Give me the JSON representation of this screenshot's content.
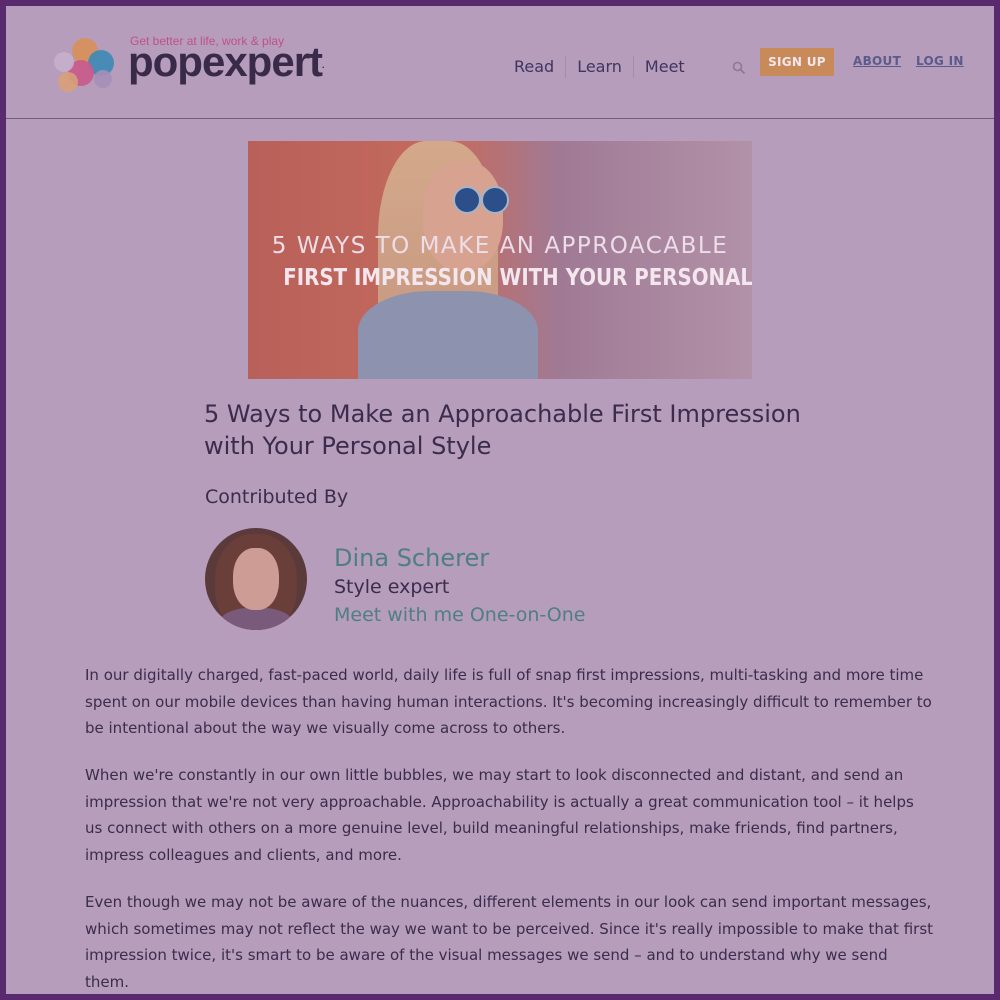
{
  "header": {
    "tagline": "Get better at life, work & play",
    "brand": "popexpert",
    "trademark": ".",
    "nav": [
      "Read",
      "Learn",
      "Meet"
    ],
    "signup_label": "SIGN UP",
    "about_label": "ABOUT",
    "login_label": "LOG IN",
    "search_icon": "search-icon"
  },
  "hero": {
    "line1": "5 WAYS TO MAKE AN APPROACABLE",
    "line2": "FIRST IMPRESSION WITH YOUR PERSONAL STYLE"
  },
  "article": {
    "title": "5 Ways to Make an Approachable First Impression with Your Personal Style",
    "contributed_by": "Contributed By",
    "author": {
      "name": "Dina Scherer",
      "role": "Style expert",
      "meet": "Meet with me One-on-One"
    },
    "paragraphs": [
      "In our digitally charged, fast-paced world, daily life is full of snap first impressions, multi-tasking and more time spent on our mobile devices than having human interactions. It's becoming increasingly difficult to remember to be intentional about the way we visually come across to others.",
      "When we're constantly in our own little bubbles, we may start to look disconnected and distant, and send an impression that we're not very approachable. Approachability is actually a great communication tool – it helps us connect with others on a more genuine level, build meaningful relationships, make friends, find partners, impress colleagues and clients, and more.",
      "Even though we may not be aware of the nuances, different elements in our look can send important messages, which sometimes may not reflect the way we want to be perceived. Since it's really impossible to make that first impression twice, it's smart to be aware of the visual messages we send – and to understand why we send them."
    ]
  },
  "colors": {
    "page_bg": "#b59dbb",
    "accent_orange": "#c98a5a",
    "author_teal": "#4f7f85",
    "frame": "#5a2a6e"
  }
}
